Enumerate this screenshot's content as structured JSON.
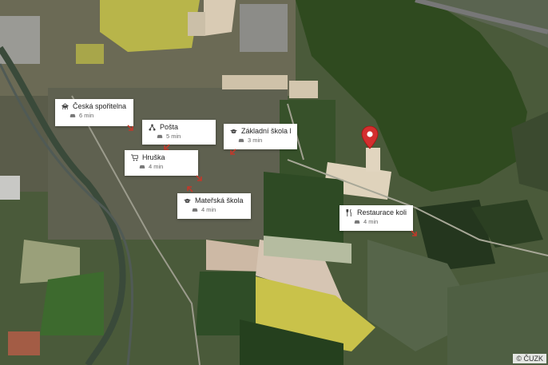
{
  "map": {
    "copyright": "© ČUZK",
    "pin_icon": "map-marker-icon",
    "pins": [
      {
        "name": "Česká spořitelna",
        "time": "6 min",
        "icon": "bank-icon"
      },
      {
        "name": "Pošta",
        "time": "5 min",
        "icon": "post-office-icon"
      },
      {
        "name": "Základní škola Da...",
        "time": "3 min",
        "icon": "school-icon"
      },
      {
        "name": "Hruška",
        "time": "4 min",
        "icon": "shopping-cart-icon"
      },
      {
        "name": "Mateřská škola V...",
        "time": "4 min",
        "icon": "school-icon"
      },
      {
        "name": "Restaurace koliba",
        "time": "4 min",
        "icon": "restaurant-icon"
      }
    ],
    "travel_icon": "car-icon",
    "accent_color": "#d32f2f"
  }
}
